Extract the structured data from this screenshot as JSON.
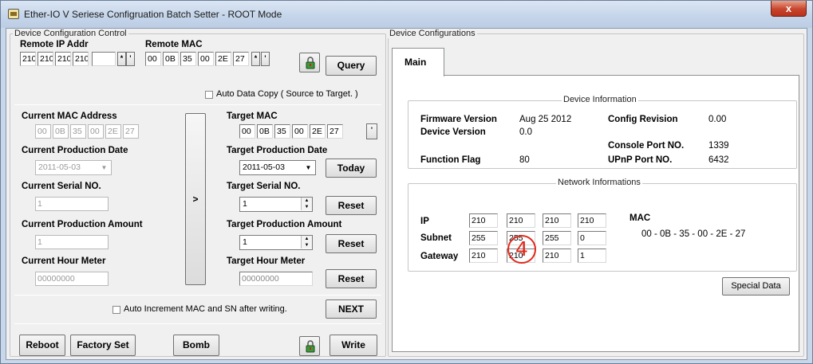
{
  "window": {
    "title": "Ether-IO V Seriese Configruation Batch Setter - ROOT Mode",
    "close_label": "x"
  },
  "left": {
    "group_title": "Device Configuration Control",
    "remote_ip_label": "Remote IP Addr",
    "remote_ip": [
      "210",
      "210",
      "210",
      "210"
    ],
    "remote_mac_label": "Remote MAC",
    "remote_mac": [
      "00",
      "0B",
      "35",
      "00",
      "2E",
      "27"
    ],
    "query_label": "Query",
    "spin_left": "*",
    "spin_right": "'",
    "auto_copy_label": "Auto Data Copy ( Source to Target. )",
    "current_mac_label": "Current MAC Address",
    "current_mac": [
      "00",
      "0B",
      "35",
      "00",
      "2E",
      "27"
    ],
    "target_mac_label": "Target MAC",
    "target_mac": [
      "00",
      "0B",
      "35",
      "00",
      "2E",
      "27"
    ],
    "target_mac_btn": "'",
    "current_prod_date_label": "Current Production Date",
    "current_prod_date": "2011-05-03",
    "target_prod_date_label": "Target Production Date",
    "target_prod_date": "2011-05-03",
    "today_label": "Today",
    "current_serial_label": "Current Serial NO.",
    "current_serial": "1",
    "target_serial_label": "Target Serial NO.",
    "target_serial": "1",
    "copy_arrow": ">",
    "reset_label": "Reset",
    "current_prod_amount_label": "Current Production Amount",
    "current_prod_amount": "1",
    "target_prod_amount_label": "Target Production Amount",
    "target_prod_amount": "1",
    "current_hour_label": "Current Hour Meter",
    "current_hour": "00000000",
    "target_hour_label": "Target Hour Meter",
    "target_hour": "00000000",
    "auto_increment_label": "Auto Increment MAC and SN after writing.",
    "next_label": "NEXT",
    "reboot_label": "Reboot",
    "factory_label": "Factory Set",
    "bomb_label": "Bomb",
    "write_label": "Write"
  },
  "right": {
    "group_title": "Device Configurations",
    "tab_main": "Main",
    "device_info_title": "Device Information",
    "firmware_label": "Firmware Version",
    "firmware_value": "Aug 25 2012",
    "device_version_label": "Device Version",
    "device_version_value": "0.0",
    "config_rev_label": "Config Revision",
    "config_rev_value": "0.00",
    "console_port_label": "Console Port NO.",
    "console_port_value": "1339",
    "function_flag_label": "Function Flag",
    "function_flag_value": "80",
    "upnp_label": "UPnP Port NO.",
    "upnp_value": "6432",
    "net_title": "Network Informations",
    "ip_label": "IP",
    "ip": [
      "210",
      "210",
      "210",
      "210"
    ],
    "subnet_label": "Subnet",
    "subnet": [
      "255",
      "255",
      "255",
      "0"
    ],
    "gateway_label": "Gateway",
    "gateway": [
      "210",
      "210",
      "210",
      "1"
    ],
    "mac_label": "MAC",
    "mac_value": "00 - 0B - 35 - 00 - 2E - 27",
    "marker": "4",
    "special_label": "Special Data"
  }
}
